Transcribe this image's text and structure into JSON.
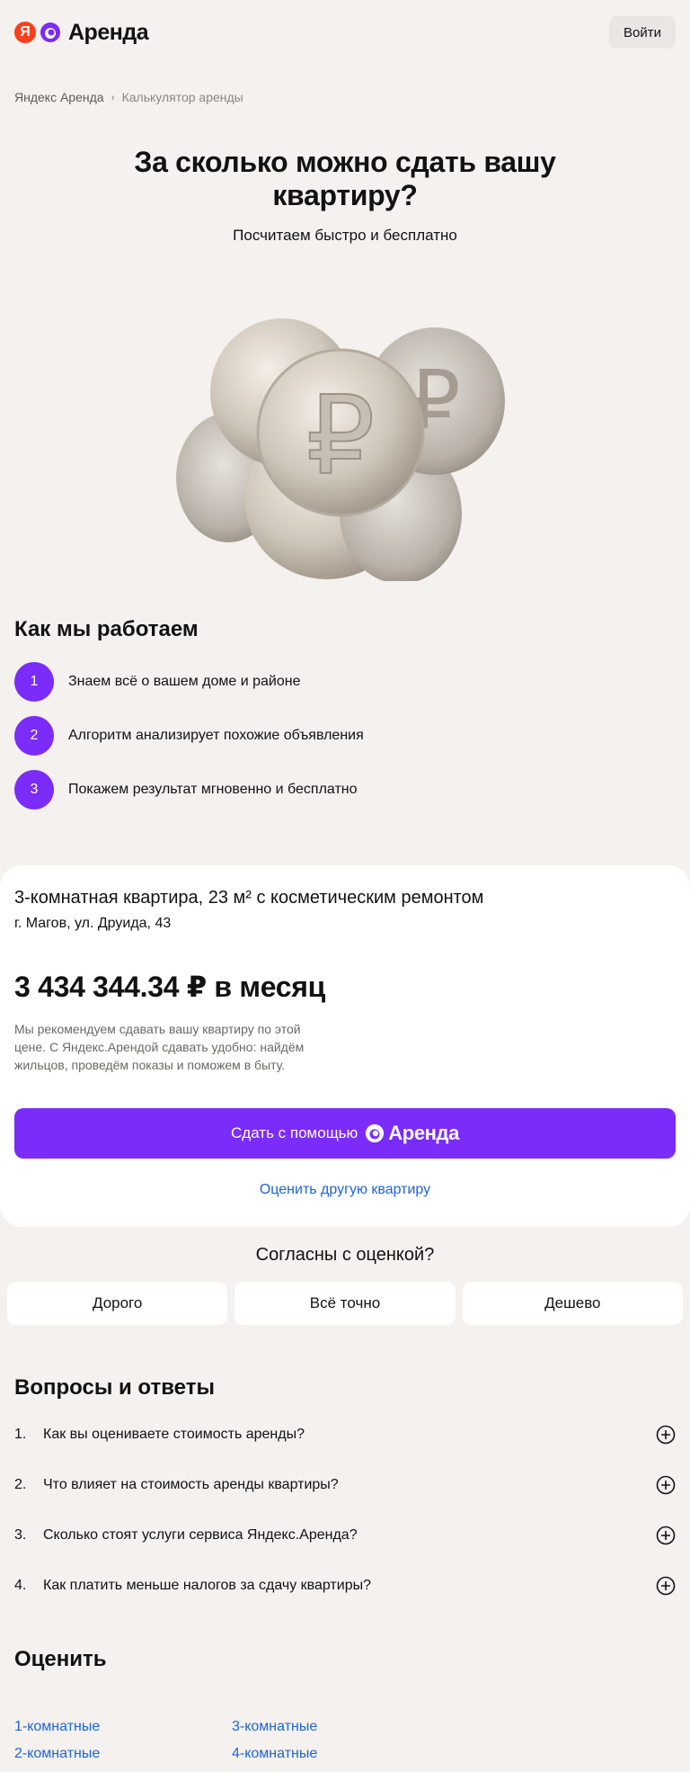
{
  "header": {
    "logo_letter": "Я",
    "logo_text": "Аренда",
    "login_label": "Войти"
  },
  "breadcrumb": {
    "home": "Яндекс Аренда",
    "separator": "›",
    "current": "Калькулятор аренды"
  },
  "hero": {
    "title": "За сколько можно сдать вашу квартиру?",
    "subtitle": "Посчитаем быстро и бесплатно"
  },
  "how": {
    "title": "Как мы работаем",
    "steps": [
      {
        "num": "1",
        "text": "Знаем всё о вашем доме и районе"
      },
      {
        "num": "2",
        "text": "Алгоритм анализирует похожие объявления"
      },
      {
        "num": "3",
        "text": "Покажем результат мгновенно и бесплатно"
      }
    ]
  },
  "result": {
    "title": "3-комнатная квартира, 23 м² с косметическим ремонтом",
    "address": "г. Магов, ул. Друида, 43",
    "price": "3 434 344.34 ₽ в месяц",
    "note": "Мы рекомендуем сдавать вашу квартиру по этой цене. С Яндекс.Арендой сдавать удобно: найдём жильцов, проведём показы и поможем в быту.",
    "rent_button": "Сдать с помощью",
    "rent_brand": "Аренда",
    "other_link": "Оценить другую квартиру"
  },
  "feedback": {
    "title": "Согласны с оценкой?",
    "options": [
      "Дорого",
      "Всё точно",
      "Дешево"
    ]
  },
  "faq": {
    "title": "Вопросы и ответы",
    "items": [
      {
        "num": "1.",
        "q": "Как вы оцениваете стоимость аренды?"
      },
      {
        "num": "2.",
        "q": "Что влияет на стоимость аренды квартиры?"
      },
      {
        "num": "3.",
        "q": "Сколько стоят услуги сервиса Яндекс.Аренда?"
      },
      {
        "num": "4.",
        "q": "Как платить меньше налогов за сдачу квартиры?"
      }
    ]
  },
  "evaluate": {
    "title": "Оценить",
    "links": [
      "1-комнатные",
      "3-комнатные",
      "2-комнатные",
      "4-комнатные"
    ]
  },
  "colors": {
    "accent": "#7b2bfa",
    "link": "#1e64d8",
    "yandex_red": "#fc3f1d",
    "background": "#f4f1ee"
  },
  "icons": {
    "coins_illustration": "ruble-coins-icon",
    "faq_expand": "plus-circle-icon"
  }
}
